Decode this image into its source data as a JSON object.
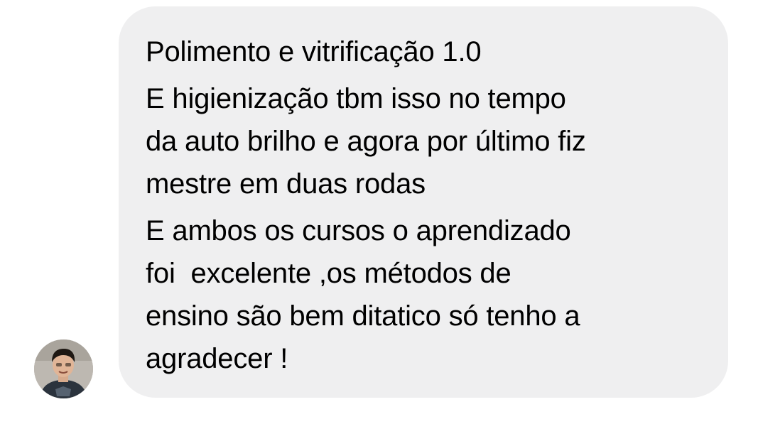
{
  "sender": {
    "avatar_icon": "profile-photo"
  },
  "message": {
    "blocks": [
      {
        "lines": [
          "Polimento e vitrificação 1.0"
        ]
      },
      {
        "lines": [
          "E higienização tbm isso no tempo",
          "da auto brilho e agora por último fiz",
          "mestre em duas rodas"
        ]
      },
      {
        "lines": [
          "E ambos os cursos o aprendizado",
          "foi  excelente ,os métodos de",
          "ensino são bem ditatico só tenho a",
          "agradecer !"
        ]
      }
    ],
    "bubble_color": "#efeff0",
    "text_color": "#000000"
  }
}
